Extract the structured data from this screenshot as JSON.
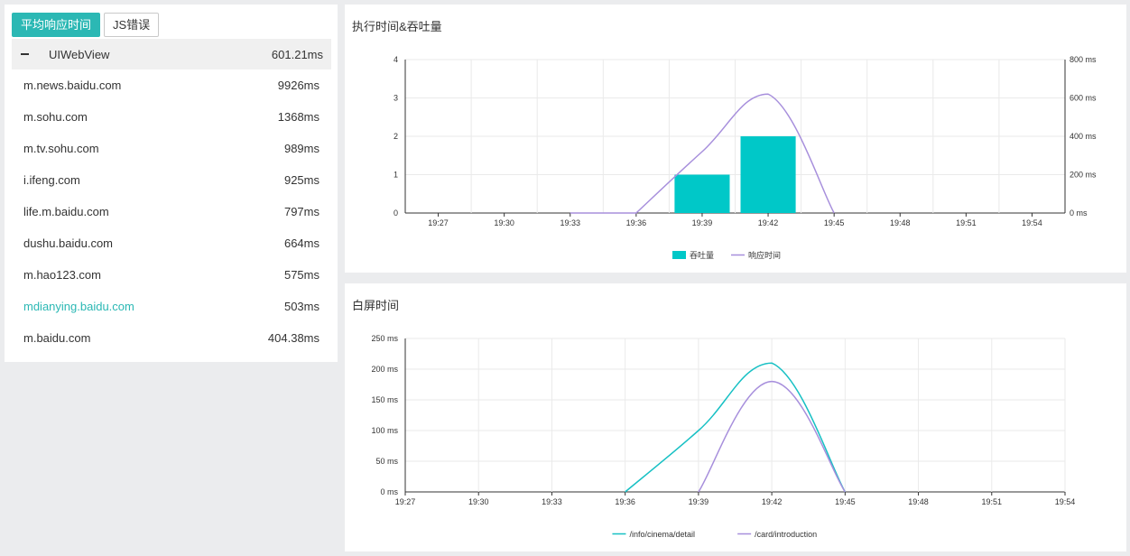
{
  "tabs": [
    {
      "label": "平均响应时间",
      "active": true
    },
    {
      "label": "JS错误",
      "active": false
    }
  ],
  "list_header": {
    "name": "UIWebView",
    "value": "601.21ms"
  },
  "list_items": [
    {
      "host": "m.news.baidu.com",
      "value": "9926ms",
      "highlight": false
    },
    {
      "host": "m.sohu.com",
      "value": "1368ms",
      "highlight": false
    },
    {
      "host": "m.tv.sohu.com",
      "value": "989ms",
      "highlight": false
    },
    {
      "host": "i.ifeng.com",
      "value": "925ms",
      "highlight": false
    },
    {
      "host": "life.m.baidu.com",
      "value": "797ms",
      "highlight": false
    },
    {
      "host": "dushu.baidu.com",
      "value": "664ms",
      "highlight": false
    },
    {
      "host": "m.hao123.com",
      "value": "575ms",
      "highlight": false
    },
    {
      "host": "mdianying.baidu.com",
      "value": "503ms",
      "highlight": true
    },
    {
      "host": "m.baidu.com",
      "value": "404.38ms",
      "highlight": false
    }
  ],
  "colors": {
    "accent": "#2bb8b4",
    "bar": "#00c8c8",
    "line_purple": "#a78fdc",
    "line_teal": "#17c0c4"
  },
  "chart_data": [
    {
      "type": "bar",
      "title": "执行时间&吞吐量",
      "x": [
        "19:27",
        "19:30",
        "19:33",
        "19:36",
        "19:39",
        "19:42",
        "19:45",
        "19:48",
        "19:51",
        "19:54"
      ],
      "ylim": [
        0,
        4
      ],
      "y_ticks": [
        "0",
        "1",
        "2",
        "3",
        "4"
      ],
      "y2lim": [
        0,
        800
      ],
      "y2_ticks": [
        "0 ms",
        "200 ms",
        "400 ms",
        "600 ms",
        "800 ms"
      ],
      "legend_position": "bottom",
      "grid": true,
      "series": [
        {
          "name": "吞吐量",
          "type": "bar",
          "axis": "left",
          "color": "#00c8c8",
          "categories": [
            "19:39",
            "19:42"
          ],
          "values": [
            1,
            2
          ]
        },
        {
          "name": "响应时间",
          "type": "line",
          "axis": "right",
          "color": "#a78fdc",
          "x": [
            "19:33",
            "19:36",
            "19:39",
            "19:42",
            "19:45"
          ],
          "values": [
            0,
            0,
            320,
            620,
            0
          ]
        }
      ]
    },
    {
      "type": "line",
      "title": "白屏时间",
      "x": [
        "19:27",
        "19:30",
        "19:33",
        "19:36",
        "19:39",
        "19:42",
        "19:45",
        "19:48",
        "19:51",
        "19:54"
      ],
      "ylim": [
        0,
        250
      ],
      "y_ticks": [
        "0 ms",
        "50 ms",
        "100 ms",
        "150 ms",
        "200 ms",
        "250 ms"
      ],
      "legend_position": "bottom",
      "grid": true,
      "series": [
        {
          "name": "/info/cinema/detail",
          "color": "#17c0c4",
          "x": [
            "19:36",
            "19:39",
            "19:42",
            "19:45"
          ],
          "values": [
            0,
            100,
            210,
            0
          ]
        },
        {
          "name": "/card/introduction",
          "color": "#a78fdc",
          "x": [
            "19:39",
            "19:42",
            "19:45"
          ],
          "values": [
            0,
            180,
            0
          ]
        }
      ]
    }
  ]
}
